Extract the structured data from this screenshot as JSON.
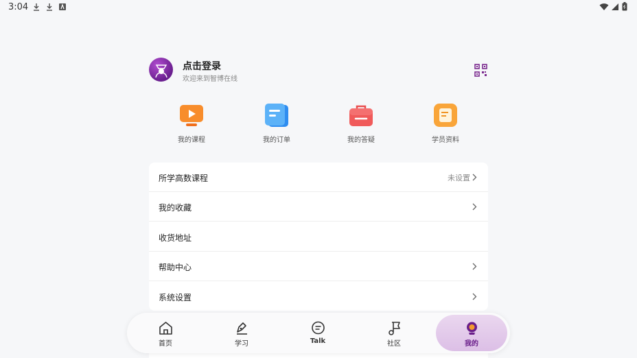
{
  "status_bar": {
    "time": "3:04"
  },
  "profile": {
    "title": "点击登录",
    "subtitle": "欢迎来到智博在线"
  },
  "quick_actions": [
    {
      "label": "我的课程",
      "icon": "course-icon"
    },
    {
      "label": "我的订单",
      "icon": "order-icon"
    },
    {
      "label": "我的答疑",
      "icon": "qa-icon"
    },
    {
      "label": "学员资料",
      "icon": "profile-icon"
    }
  ],
  "menu": [
    {
      "label": "所学高数课程",
      "value": "未设置",
      "chevron": true
    },
    {
      "label": "我的收藏",
      "value": "",
      "chevron": true
    },
    {
      "label": "收货地址",
      "value": "",
      "chevron": false
    },
    {
      "label": "帮助中心",
      "value": "",
      "chevron": true
    },
    {
      "label": "系统设置",
      "value": "",
      "chevron": true
    }
  ],
  "nav": [
    {
      "label": "首页",
      "icon": "home-icon"
    },
    {
      "label": "学习",
      "icon": "study-icon"
    },
    {
      "label": "Talk",
      "icon": "talk-icon"
    },
    {
      "label": "社区",
      "icon": "community-icon"
    },
    {
      "label": "我的",
      "icon": "mine-icon",
      "active": true
    }
  ],
  "colors": {
    "accent": "#6a1e8a",
    "background": "#f6f7f9"
  }
}
